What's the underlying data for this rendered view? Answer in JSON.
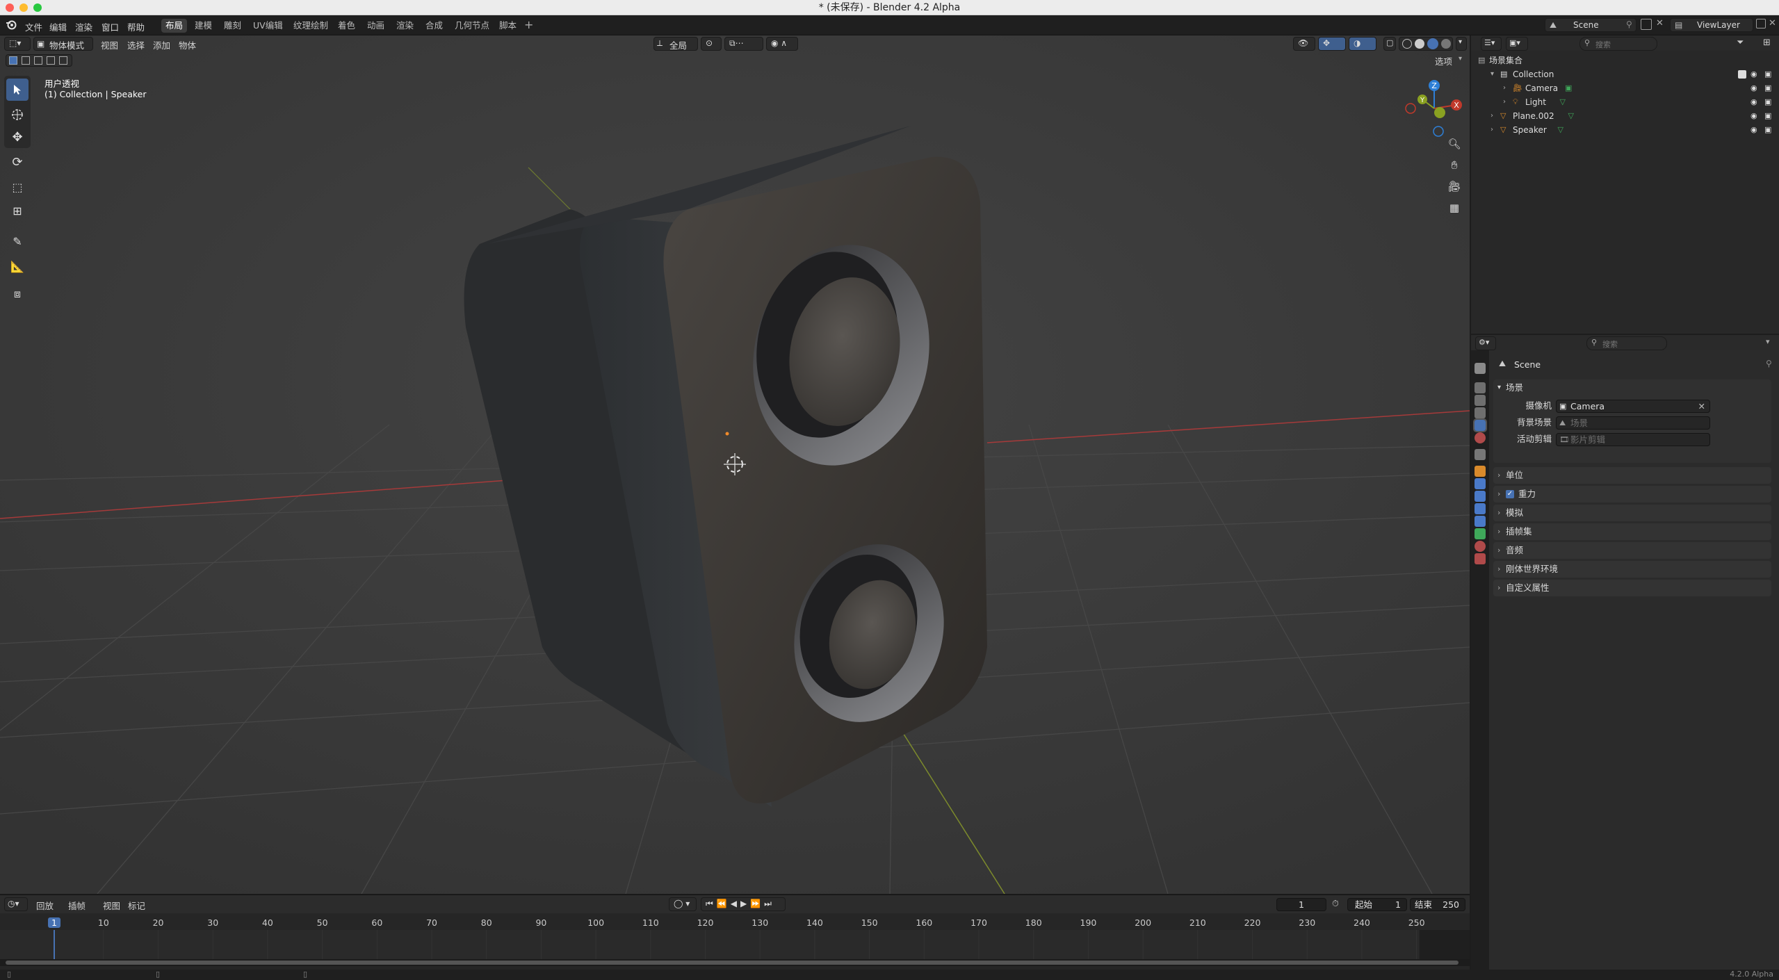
{
  "window": {
    "title": "* (未保存) - Blender 4.2 Alpha"
  },
  "menu": {
    "file": "文件",
    "edit": "编辑",
    "render": "渲染",
    "window": "窗口",
    "help": "帮助"
  },
  "workspaces": [
    "布局",
    "建模",
    "雕刻",
    "UV编辑",
    "纹理绘制",
    "着色",
    "动画",
    "渲染",
    "合成",
    "几何节点",
    "脚本"
  ],
  "viewport": {
    "mode": "物体模式",
    "menus": {
      "view": "视图",
      "select": "选择",
      "add": "添加",
      "object": "物体"
    },
    "transform_orientation": "全局",
    "options_label": "选项",
    "overlay_text": {
      "view_name": "用户透视",
      "context": "(1) Collection | Speaker"
    },
    "gizmo": {
      "x": "X",
      "y": "Y",
      "z": "Z"
    }
  },
  "timeline": {
    "menus": {
      "playback": "回放",
      "keying": "插帧",
      "view": "视图",
      "marker": "标记"
    },
    "current_frame": "1",
    "start_label": "起始",
    "start_value": "1",
    "end_label": "结束",
    "end_value": "250",
    "ruler": [
      "1",
      "10",
      "20",
      "30",
      "40",
      "50",
      "60",
      "70",
      "80",
      "90",
      "100",
      "110",
      "120",
      "130",
      "140",
      "150",
      "160",
      "170",
      "180",
      "190",
      "200",
      "210",
      "220",
      "230",
      "240",
      "250"
    ]
  },
  "topright": {
    "scene": "Scene",
    "view_layer": "ViewLayer"
  },
  "outliner": {
    "search_placeholder": "搜索",
    "root": "场景集合",
    "items": [
      {
        "name": "Collection",
        "depth": 1
      },
      {
        "name": "Camera",
        "depth": 2
      },
      {
        "name": "Light",
        "depth": 2
      },
      {
        "name": "Plane.002",
        "depth": 1
      },
      {
        "name": "Speaker",
        "depth": 1
      }
    ]
  },
  "properties": {
    "search_placeholder": "搜索",
    "context": "Scene",
    "scene_panel": {
      "title": "场景",
      "camera_label": "摄像机",
      "camera_value": "Camera",
      "background_label": "背景场景",
      "background_placeholder": "场景",
      "clip_label": "活动剪辑",
      "clip_placeholder": "影片剪辑"
    },
    "panels": [
      "单位",
      "重力",
      "模拟",
      "插帧集",
      "音频",
      "刚体世界环境",
      "自定义属性"
    ],
    "gravity_checked": true
  },
  "status": {
    "version": "4.2.0 Alpha"
  },
  "colors": {
    "accent": "#4772b3",
    "viewport_bg": "#3a3a3a",
    "panel_bg": "#2b2b2b",
    "x_axis": "#c0392b",
    "y_axis": "#8aa121",
    "z_axis": "#2e7fd6"
  }
}
